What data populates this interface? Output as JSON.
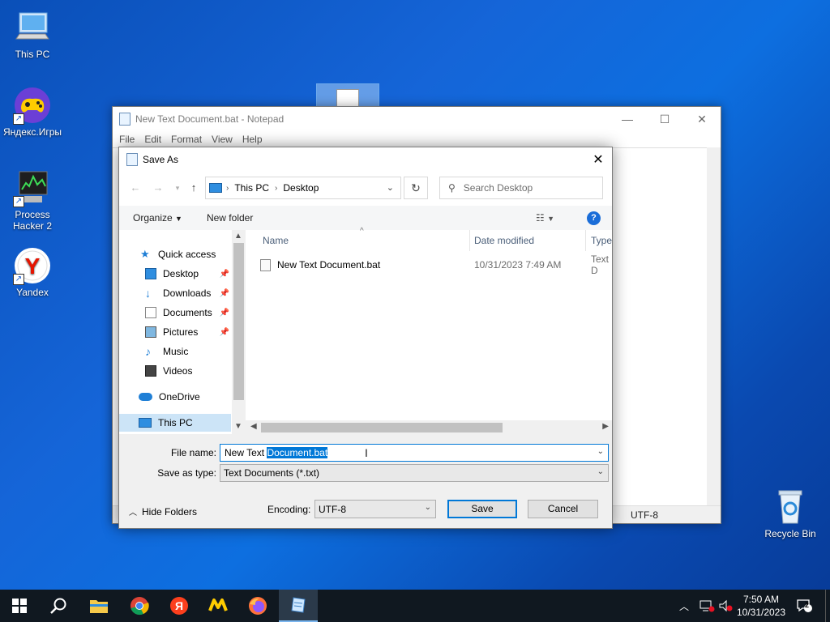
{
  "desktop": {
    "icons": [
      {
        "label": "This PC"
      },
      {
        "label": "Яндекс.Игры"
      },
      {
        "label": "Process Hacker 2"
      },
      {
        "label": "Yandex"
      },
      {
        "label": "Recycle Bin"
      }
    ]
  },
  "notepad": {
    "title": "New Text Document.bat - Notepad",
    "menu": [
      "File",
      "Edit",
      "Format",
      "View",
      "Help"
    ],
    "encoding_status": "UTF-8"
  },
  "dialog": {
    "title": "Save As",
    "address": {
      "segments": [
        "This PC",
        "Desktop"
      ]
    },
    "search_placeholder": "Search Desktop",
    "toolbar": {
      "organize": "Organize",
      "new_folder": "New folder"
    },
    "nav": [
      {
        "label": "Quick access"
      },
      {
        "label": "Desktop"
      },
      {
        "label": "Downloads"
      },
      {
        "label": "Documents"
      },
      {
        "label": "Pictures"
      },
      {
        "label": "Music"
      },
      {
        "label": "Videos"
      },
      {
        "label": "OneDrive"
      },
      {
        "label": "This PC"
      }
    ],
    "columns": [
      "Name",
      "Date modified",
      "Type"
    ],
    "files": [
      {
        "name": "New Text Document.bat",
        "date": "10/31/2023 7:49 AM",
        "type": "Text D"
      }
    ],
    "file_name_label": "File name:",
    "file_name_plain": "New Text ",
    "file_name_selected": "Document.bat",
    "save_type_label": "Save as type:",
    "save_type_value": "Text Documents (*.txt)",
    "hide_folders": "Hide Folders",
    "encoding_label": "Encoding:",
    "encoding_value": "UTF-8",
    "save_button": "Save",
    "cancel_button": "Cancel"
  },
  "taskbar": {
    "time": "7:50 AM",
    "date": "10/31/2023",
    "notification_count": "2"
  }
}
